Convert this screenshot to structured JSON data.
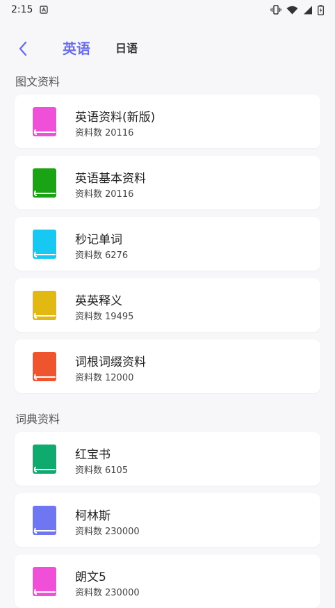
{
  "status_bar": {
    "time": "2:15"
  },
  "header": {
    "tabs": [
      {
        "label": "英语"
      },
      {
        "label": "日语"
      }
    ]
  },
  "sections": [
    {
      "title": "图文资料",
      "items": [
        {
          "title": "英语资料(新版)",
          "count_label": "资料数",
          "count": "20116",
          "color": "#f04fd8"
        },
        {
          "title": "英语基本资料",
          "count_label": "资料数",
          "count": "20116",
          "color": "#1aa312"
        },
        {
          "title": "秒记单词",
          "count_label": "资料数",
          "count": "6276",
          "color": "#17c9f2"
        },
        {
          "title": "英英释义",
          "count_label": "资料数",
          "count": "19495",
          "color": "#e2b812"
        },
        {
          "title": "词根词缀资料",
          "count_label": "资料数",
          "count": "12000",
          "color": "#ee542d"
        }
      ]
    },
    {
      "title": "词典资料",
      "items": [
        {
          "title": "红宝书",
          "count_label": "资料数",
          "count": "6105",
          "color": "#0fab6e"
        },
        {
          "title": "柯林斯",
          "count_label": "资料数",
          "count": "230000",
          "color": "#6f76f2"
        },
        {
          "title": "朗文5",
          "count_label": "资料数",
          "count": "230000",
          "color": "#f04fd8"
        }
      ]
    }
  ]
}
